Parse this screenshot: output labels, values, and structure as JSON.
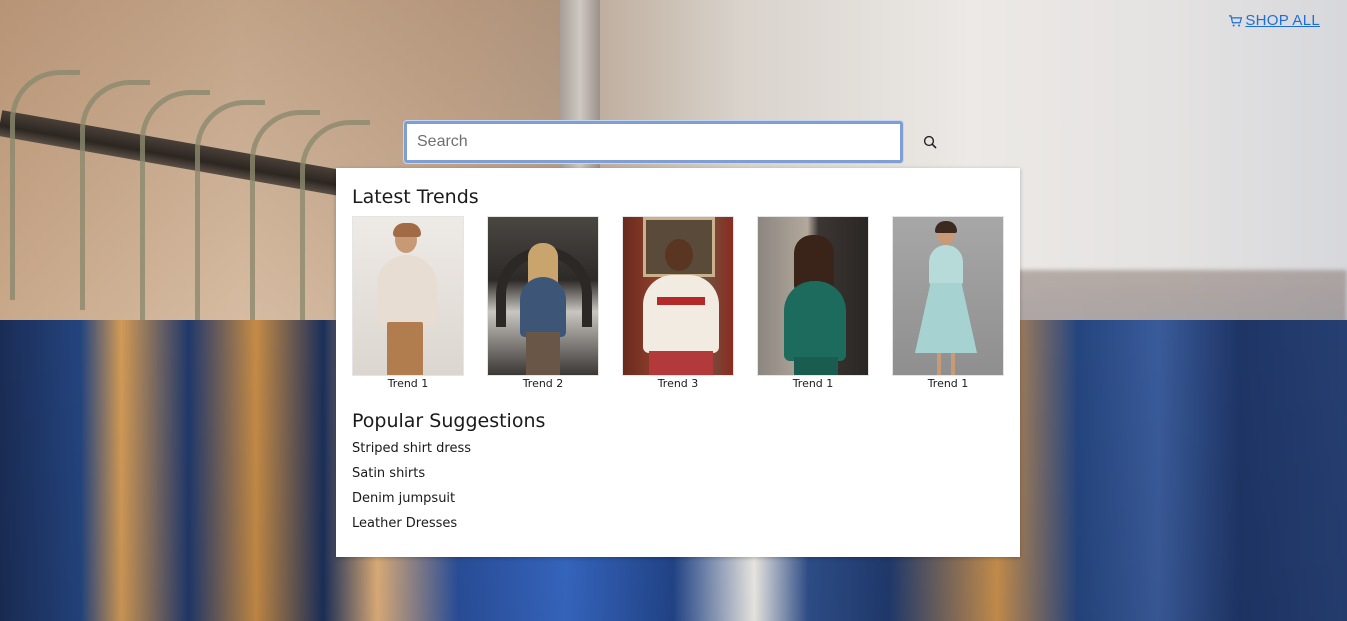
{
  "header": {
    "shop_all_label": "SHOP ALL",
    "link_color": "#1d6fd8"
  },
  "search": {
    "value": "",
    "placeholder": "Search"
  },
  "dropdown": {
    "latest_trends_title": "Latest Trends",
    "trends": [
      {
        "label": "Trend 1",
        "icon": "photo-woman-beige-outfit"
      },
      {
        "label": "Trend 2",
        "icon": "photo-woman-denim-jacket"
      },
      {
        "label": "Trend 3",
        "icon": "photo-woman-sweatshirt"
      },
      {
        "label": "Trend 1",
        "icon": "photo-woman-green-suit"
      },
      {
        "label": "Trend 1",
        "icon": "photo-woman-floral-dress"
      }
    ],
    "popular_title": "Popular Suggestions",
    "suggestions": [
      "Striped shirt dress",
      "Satin shirts",
      "Denim jumpsuit",
      "Leather Dresses"
    ]
  }
}
